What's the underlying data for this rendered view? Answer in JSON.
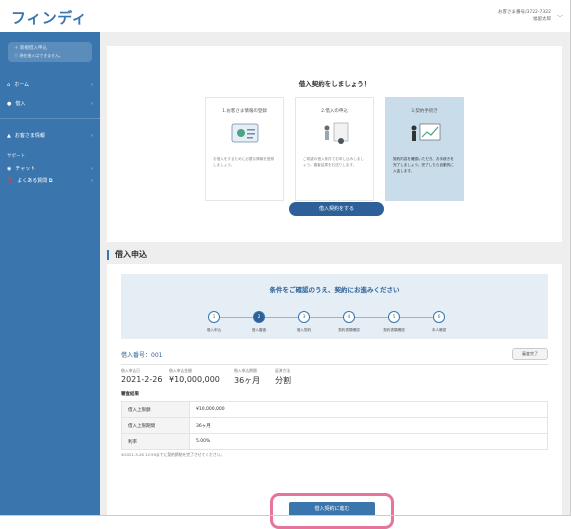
{
  "header": {
    "logo": "フィンディ",
    "account_number": "お客さま番号/3722-7322",
    "account_name": "福留太郎"
  },
  "sidebar": {
    "apply_button": "＋ 新規借入申込",
    "apply_note": "ⓘ 現在借入はできません。",
    "items": [
      {
        "label": "ホーム",
        "icon": "home-icon"
      },
      {
        "label": "借入",
        "icon": "money-icon"
      },
      {
        "label": "お客さま情報",
        "icon": "user-icon"
      }
    ],
    "support_heading": "サポート",
    "support_items": [
      {
        "label": "チャット",
        "icon": "chat-icon"
      },
      {
        "label": "よくある質問 ⧉",
        "icon": "help-icon"
      }
    ]
  },
  "contract_prompt": {
    "title": "借入契約をしましょう！",
    "steps": [
      {
        "title": "1.お客さま情報の登録",
        "desc": "お借入をするために必要な情報を登録しましょう。"
      },
      {
        "title": "2.借入の申込",
        "desc": "ご希望の借入条件でお申し込みしましょう。審査結果をお送りします。"
      },
      {
        "title": "3.契約手続き",
        "desc": "契約内容を確認いただき、お手続きを完了しましょう。完了したら自動的に入金します。"
      }
    ],
    "button": "借入契約をする"
  },
  "application": {
    "section_title": "借入申込",
    "progress_title": "条件をご確認のうえ、契約にお進みください",
    "progress_steps": [
      {
        "num": "1",
        "label": "借入申込"
      },
      {
        "num": "2",
        "label": "借入審査"
      },
      {
        "num": "3",
        "label": "借入契約"
      },
      {
        "num": "4",
        "label": "契約書類確認"
      },
      {
        "num": "5",
        "label": "契約書類確認"
      },
      {
        "num": "6",
        "label": "本人確認"
      }
    ],
    "current_step": 2,
    "application_number": "借入番号：001",
    "status_badge": "審査完了",
    "info": [
      {
        "label": "借入申込日",
        "value": "2021-2-26"
      },
      {
        "label": "借入申込金額",
        "value": "¥10,000,000"
      },
      {
        "label": "借入申込期間",
        "value": "36ヶ月"
      },
      {
        "label": "返済方法",
        "value": "分割"
      }
    ],
    "result_heading": "審査結果",
    "result_rows": [
      {
        "key": "借入上限額",
        "value": "¥10,000,000"
      },
      {
        "key": "借入上限期間",
        "value": "36ヶ月"
      },
      {
        "key": "利率",
        "value": "5.00%"
      }
    ],
    "note": "※2021-3-26 12:59までに契約締結を完了させてください。",
    "proceed_button": "借入契約に進む"
  },
  "colors": {
    "sidebar": "#3a75ad",
    "primary_button": "#2d5f98",
    "highlight": "#e6749c"
  }
}
